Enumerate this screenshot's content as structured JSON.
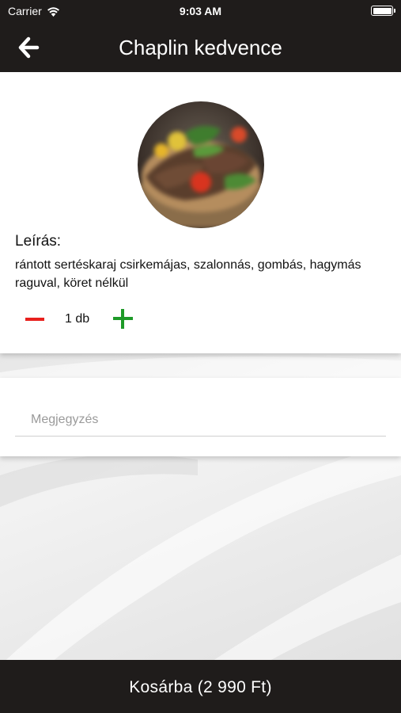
{
  "status_bar": {
    "carrier": "Carrier",
    "time": "9:03 AM",
    "icons": [
      "wifi-icon",
      "battery-icon"
    ]
  },
  "nav": {
    "back_icon": "back-arrow-icon",
    "title": "Chaplin kedvence"
  },
  "product": {
    "image_icon": "food-photo",
    "description_label": "Leírás:",
    "description": "rántott sertéskaraj csirkemájas, szalonnás, gombás, hagymás raguval, köret nélkül",
    "quantity": "1 db",
    "decrement_icon": "minus-icon",
    "increment_icon": "plus-icon"
  },
  "note": {
    "placeholder": "Megjegyzés",
    "value": ""
  },
  "cart_button": {
    "label": "Kosárba (2 990 Ft)"
  },
  "colors": {
    "bar_background": "#1f1c1b",
    "minus": "#e8201d",
    "plus": "#1e9a28"
  }
}
